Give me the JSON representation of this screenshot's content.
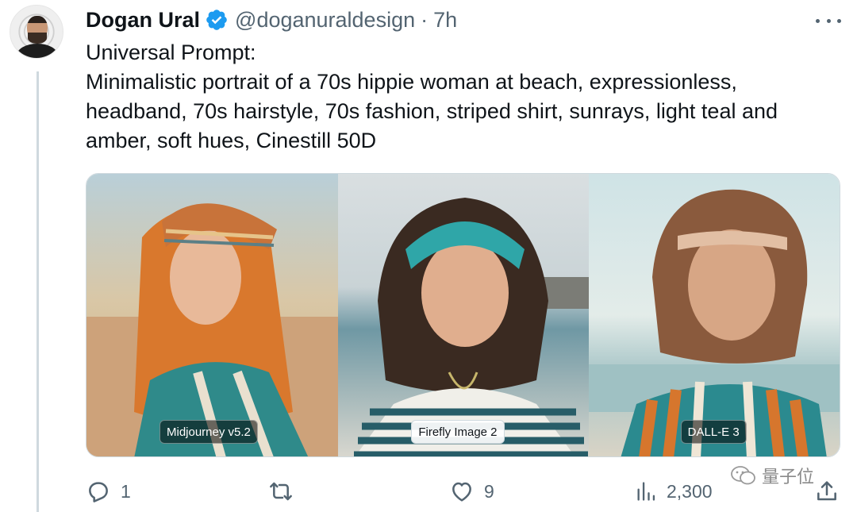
{
  "author": {
    "name": "Dogan Ural",
    "handle": "@doganuraldesign",
    "separator": "·",
    "time": "7h",
    "verified": true
  },
  "tweet": {
    "lines": [
      "Universal Prompt:",
      "Minimalistic portrait of a 70s hippie woman at beach, expressionless,",
      "headband, 70s hairstyle, 70s fashion, striped shirt, sunrays, light teal and",
      "amber, soft hues, Cinestill 50D"
    ]
  },
  "media": {
    "panels": [
      {
        "label": "Midjourney v5.2"
      },
      {
        "label": "Firefly Image 2"
      },
      {
        "label": "DALL-E 3"
      }
    ]
  },
  "actions": {
    "reply_count": "1",
    "like_count": "9",
    "views_count": "2,300"
  },
  "watermark": {
    "text": "量子位"
  },
  "colors": {
    "verified": "#1d9bf0",
    "secondary_text": "#536471",
    "primary_text": "#0f1419"
  },
  "icons": [
    "more-icon",
    "verified-badge-icon",
    "reply-icon",
    "retweet-icon",
    "like-icon",
    "views-icon",
    "share-icon",
    "wechat-icon"
  ]
}
